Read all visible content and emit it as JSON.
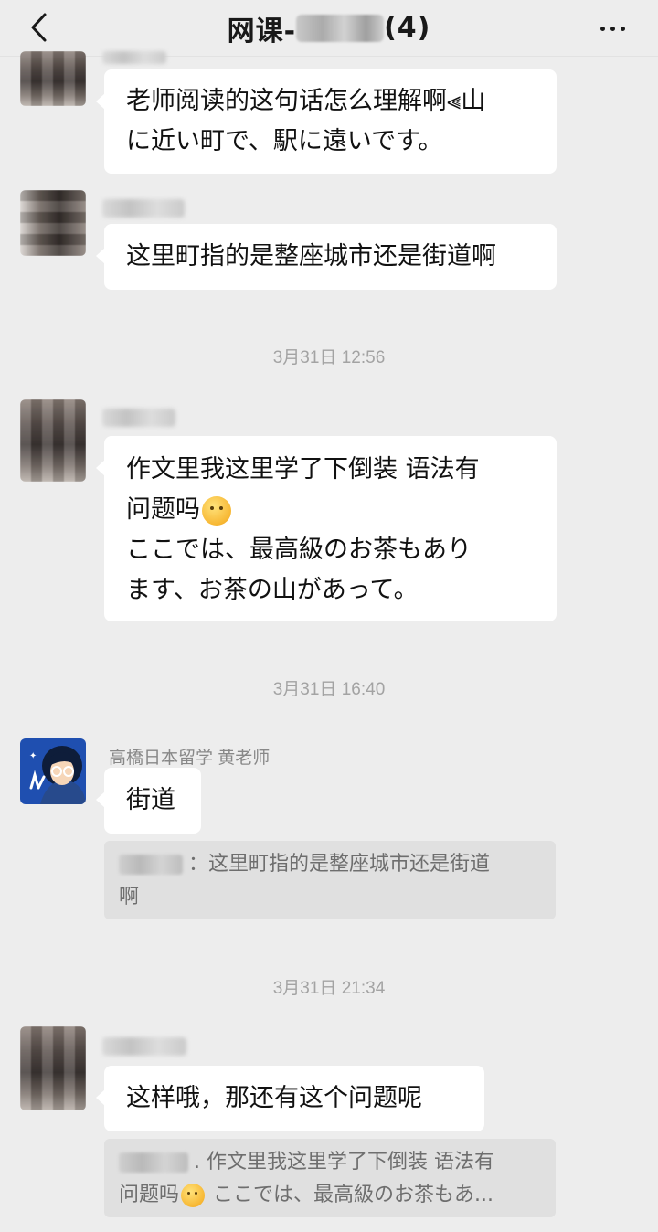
{
  "header": {
    "title_prefix": "网课-",
    "title_suffix": "(4)"
  },
  "messages": [
    {
      "lines": [
        "老师阅读的这句话怎么理解啊⫷山",
        "に近い町で、駅に遠いです。"
      ]
    },
    {
      "lines": [
        "这里町指的是整座城市还是街道啊"
      ]
    },
    {
      "lines": [
        "作文里我这里学了下倒装 语法有",
        "问题吗",
        "ここでは、最高級のお茶もあり",
        "ます、お茶の山があって。"
      ]
    },
    {
      "sender": "高橋日本留学 黄老师",
      "lines": [
        "街道"
      ],
      "quote": [
        "：这里町指的是整座城市还是街道",
        "啊"
      ]
    },
    {
      "lines": [
        "这样哦，那还有这个问题呢"
      ],
      "quote": [
        ". 作文里我这里学了下倒装 语法有",
        "问题吗",
        " ここでは、最高級のお茶もあ..."
      ]
    }
  ],
  "timestamps": [
    "3月31日 12:56",
    "3月31日 16:40",
    "3月31日 21:34"
  ],
  "icons": {
    "back": "chevron-left-icon",
    "more": "more-dots-icon",
    "emoji": "thinking-face-emoji"
  }
}
